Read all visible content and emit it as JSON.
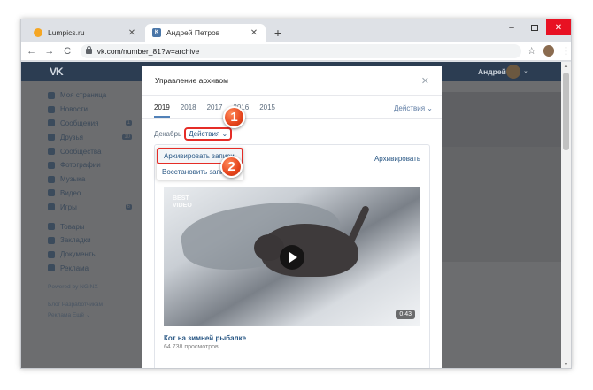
{
  "browser": {
    "tabs": [
      {
        "title": "Lumpics.ru",
        "close": "✕"
      },
      {
        "title": "Андрей Петров",
        "close": "✕"
      }
    ],
    "new_tab": "+",
    "window_controls": {
      "minimize": "–",
      "close": "✕"
    },
    "nav": {
      "back": "←",
      "forward": "→",
      "reload": "C"
    },
    "url": "vk.com/number_81?w=archive",
    "star": "☆",
    "menu": "⋮"
  },
  "vk": {
    "logo": "VK",
    "user": "Андрей",
    "user_caret": "⌄",
    "sidebar": [
      {
        "label": "Моя страница",
        "count": ""
      },
      {
        "label": "Новости",
        "count": ""
      },
      {
        "label": "Сообщения",
        "count": "1"
      },
      {
        "label": "Друзья",
        "count": "10"
      },
      {
        "label": "Сообщества",
        "count": ""
      },
      {
        "label": "Фотографии",
        "count": ""
      },
      {
        "label": "Музыка",
        "count": ""
      },
      {
        "label": "Видео",
        "count": ""
      },
      {
        "label": "Игры",
        "count": "6"
      },
      {
        "label": "Товары",
        "count": ""
      },
      {
        "label": "Закладки",
        "count": ""
      },
      {
        "label": "Документы",
        "count": ""
      },
      {
        "label": "Реклама",
        "count": ""
      }
    ],
    "sidebar_footer": {
      "powered": "Powered by NGINX",
      "links1": "Блог   Разработчикам",
      "links2": "Реклама   Ещё ⌄"
    }
  },
  "modal": {
    "title": "Управление архивом",
    "close": "✕",
    "years": [
      "2019",
      "2018",
      "2017",
      "2016",
      "2015"
    ],
    "active_year": "2019",
    "actions_label": "Действия ⌄",
    "month_label": "Декабрь",
    "month_actions": "Действия ⌄",
    "dropdown": {
      "archive": "Архивировать записи",
      "restore": "Восстановить запи"
    },
    "archive_link": "Архивировать",
    "video": {
      "watermark": "BEST\nVIDEO",
      "duration": "0:43",
      "title": "Кот на зимней рыбалке",
      "views": "64 738 просмотров"
    }
  },
  "annotations": {
    "badge1": "1",
    "badge2": "2"
  },
  "colors": {
    "vk_header": "#2c3d52",
    "link": "#2a5885",
    "highlight": "#e52d27",
    "badge": "#e5441c"
  }
}
